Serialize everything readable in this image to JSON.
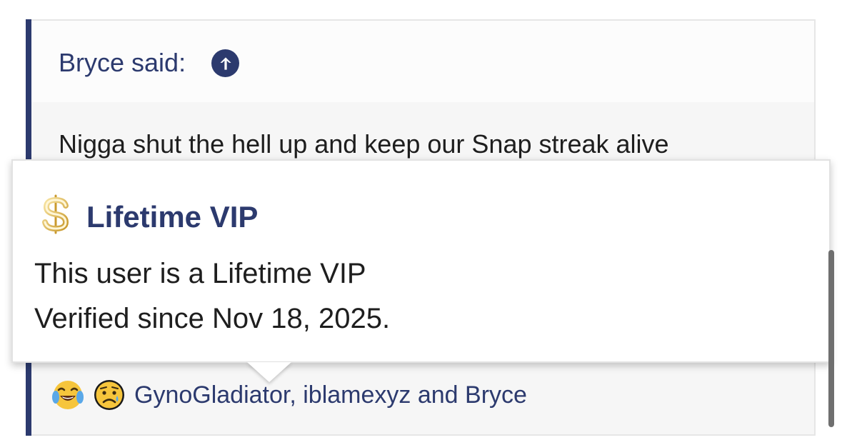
{
  "quote": {
    "author_label": "Bryce said:",
    "text": "Nigga shut the hell up and keep our Snap streak alive"
  },
  "tooltip": {
    "title": "Lifetime VIP",
    "line1": "This user is a Lifetime VIP",
    "line2": "Verified since Nov 18, 2025.",
    "icon": "dollar-sign-icon"
  },
  "reactions": {
    "emojis": [
      "laughing-crying-emoji",
      "sad-emoji"
    ],
    "users_text": "GynoGladiator, iblamexyz and Bryce"
  },
  "colors": {
    "accent": "#2c3a6e",
    "text": "#1e1e1e",
    "quote_bg": "#f6f6f6"
  }
}
